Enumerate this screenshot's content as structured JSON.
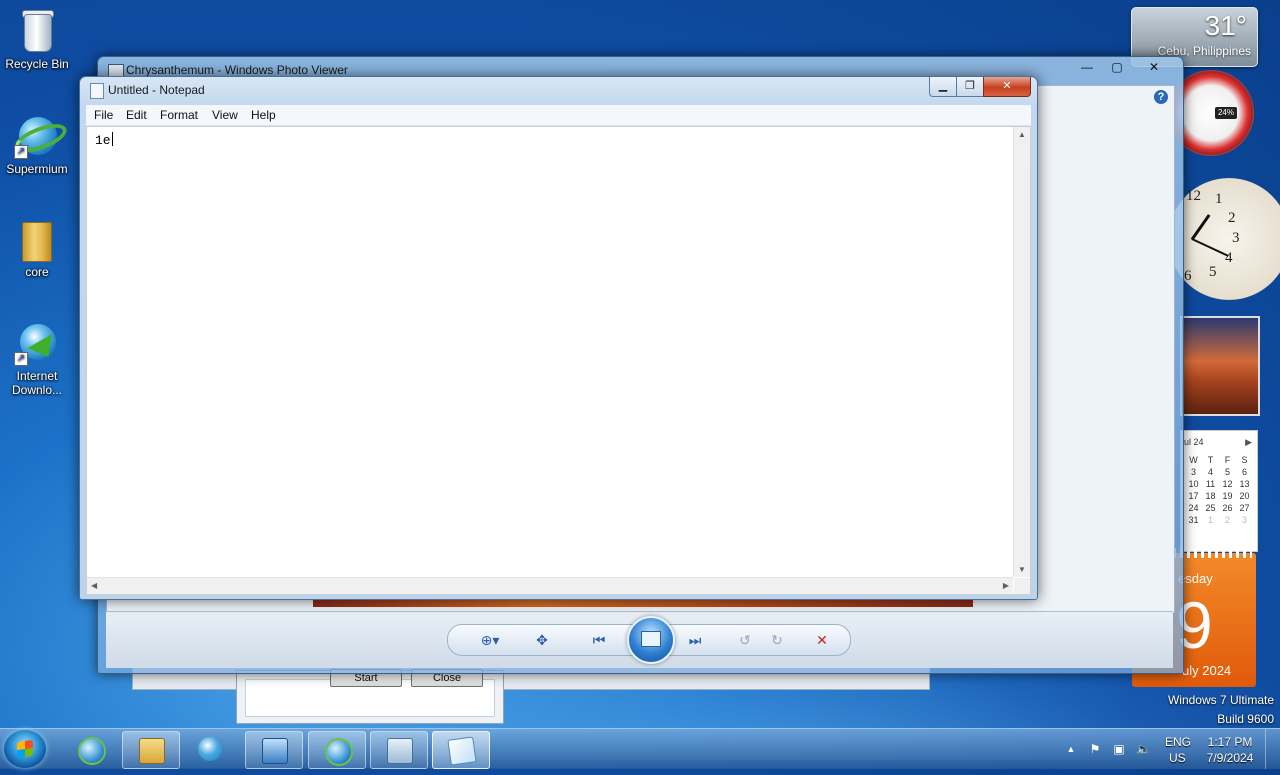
{
  "desktop": {
    "icons": [
      {
        "label": "Recycle Bin"
      },
      {
        "label": "Supermium"
      },
      {
        "label": "core"
      },
      {
        "label": "Internet Downlo..."
      }
    ],
    "watermark": {
      "line1": "Windows 7 Ultimate",
      "line2": "Build 9600"
    }
  },
  "gadgets": {
    "weather": {
      "temp": "31°",
      "location": "Cebu, Philippines"
    },
    "meter": {
      "percent": "24%"
    },
    "clock": {
      "numbers": [
        "12",
        "1",
        "2",
        "3",
        "4",
        "5",
        "6"
      ]
    },
    "calendar": {
      "month": "ul 24",
      "weekdays": [
        "W",
        "T",
        "F",
        "S"
      ],
      "rows": [
        [
          "3",
          "4",
          "5",
          "6"
        ],
        [
          "10",
          "11",
          "12",
          "13"
        ],
        [
          "17",
          "18",
          "19",
          "20"
        ],
        [
          "24",
          "25",
          "26",
          "27"
        ],
        [
          "31",
          "1",
          "2",
          "3"
        ]
      ],
      "day_name": "esday",
      "day_number": "9",
      "month_year": "uly 2024"
    }
  },
  "photo_viewer": {
    "title": "Chrysanthemum - Windows Photo Viewer",
    "help": "?"
  },
  "background_dialog": {
    "start_label": "Start",
    "close_label": "Close"
  },
  "notepad": {
    "title": "Untitled - Notepad",
    "menu": [
      "File",
      "Edit",
      "Format",
      "View",
      "Help"
    ],
    "content": "1e"
  },
  "taskbar": {
    "lang": "ENG",
    "region": "US",
    "time": "1:17 PM",
    "date": "7/9/2024"
  },
  "colors": {
    "desktop_bg": "#1c72c8",
    "close_button": "#c4411f",
    "accent_orange": "#e05a0a"
  }
}
